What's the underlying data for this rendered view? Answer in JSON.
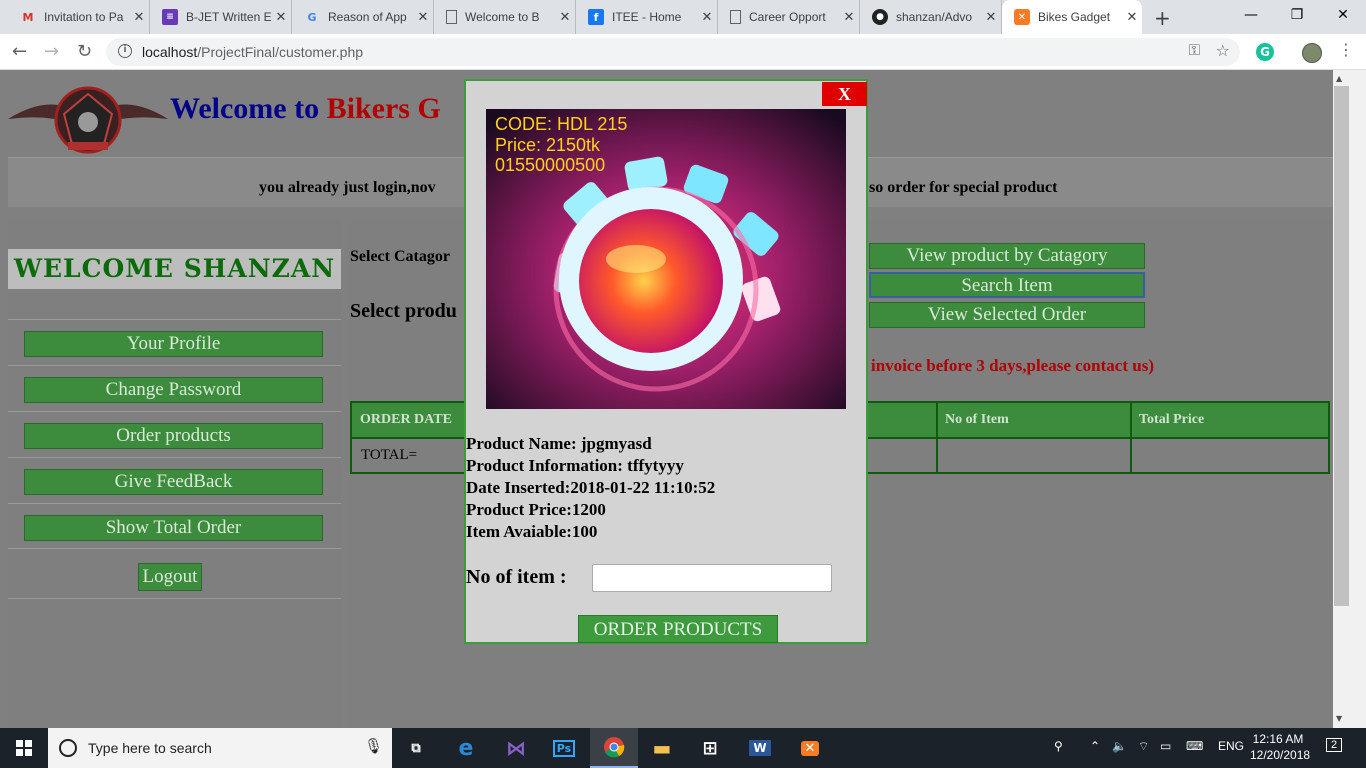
{
  "browser": {
    "tabs": [
      {
        "title": "Invitation to Pa",
        "icon": "gmail-icon",
        "active": false
      },
      {
        "title": "B-JET Written E",
        "icon": "forms-icon",
        "active": false
      },
      {
        "title": "Reason of App",
        "icon": "google-icon",
        "active": false
      },
      {
        "title": "Welcome to B",
        "icon": "page-icon",
        "active": false
      },
      {
        "title": "ITEE - Home",
        "icon": "facebook-icon",
        "active": false
      },
      {
        "title": "Career Opport",
        "icon": "page-icon",
        "active": false
      },
      {
        "title": "shanzan/Advo",
        "icon": "github-icon",
        "active": false
      },
      {
        "title": "Bikes Gadget",
        "icon": "xampp-icon",
        "active": true
      }
    ],
    "url_host": "localhost",
    "url_path": "/ProjectFinal/customer.php"
  },
  "site": {
    "title_part1": "Welcome to",
    "title_part2": "Bikers G",
    "notice_left": "you already just login,nov",
    "notice_right": "so order for special product"
  },
  "sidebar": {
    "welcome": "WELCOME SHANZAN",
    "items": [
      "Your Profile",
      "Change Password",
      "Order products",
      "Give FeedBack",
      "Show Total Order"
    ],
    "logout": "Logout"
  },
  "main": {
    "select_category_label": "Select Catagor",
    "select_product_label": "Select produ",
    "buttons": [
      "View product by Catagory",
      "Search Item",
      "View Selected Order"
    ],
    "warning": "invoice before 3 days,please contact us)",
    "table": {
      "headers": [
        "ORDER DATE",
        "No of Item",
        "Total Price"
      ],
      "total_label": "TOTAL="
    }
  },
  "modal": {
    "close": "X",
    "image_text": [
      "CODE: HDL 215",
      "Price: 2150tk",
      "01550000500"
    ],
    "product_name": "Product Name: jpgmyasd",
    "product_info": "Product Information: tffytyyy",
    "date_inserted": "Date Inserted:2018-01-22 11:10:52",
    "product_price": "Product Price:1200",
    "item_available": "Item Avaiable:100",
    "no_of_item_label": "No of item :",
    "no_of_item_value": "",
    "order_button": "ORDER PRODUCTS"
  },
  "taskbar": {
    "search_placeholder": "Type here to search",
    "lang": "ENG",
    "time": "12:16 AM",
    "date": "12/20/2018",
    "notifications": "2"
  }
}
